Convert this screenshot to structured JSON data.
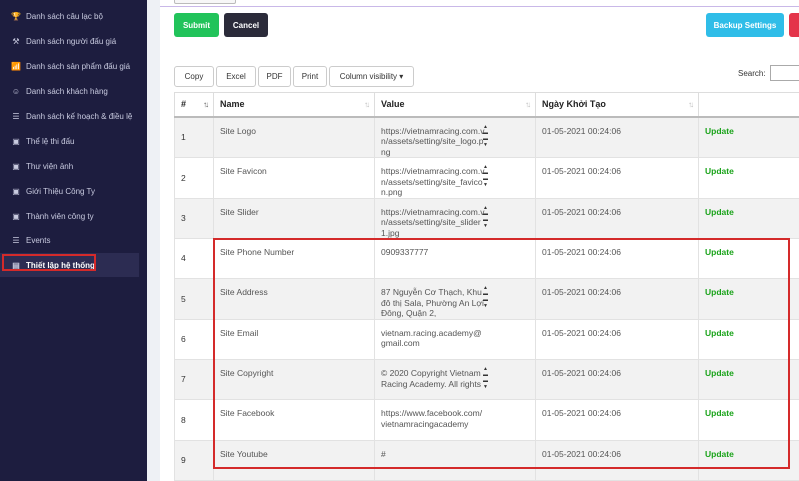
{
  "sidebar": {
    "items": [
      {
        "label": "Danh sách câu lạc bộ",
        "icon": "trophy-icon",
        "glyph": "🏆"
      },
      {
        "label": "Danh sách người đấu giá",
        "icon": "gavel-icon",
        "glyph": "⚒"
      },
      {
        "label": "Danh sách sản phẩm đấu giá",
        "icon": "bar-chart-icon",
        "glyph": "📶"
      },
      {
        "label": "Danh sách khách hàng",
        "icon": "user-circle-icon",
        "glyph": "☺"
      },
      {
        "label": "Danh sách kế hoạch & điều lệ",
        "icon": "list-icon",
        "glyph": "☰"
      },
      {
        "label": "Thể lệ thi đấu",
        "icon": "image-icon",
        "glyph": "▣"
      },
      {
        "label": "Thư viện ảnh",
        "icon": "image-icon",
        "glyph": "▣"
      },
      {
        "label": "Giới Thiệu Công Ty",
        "icon": "image-icon",
        "glyph": "▣"
      },
      {
        "label": "Thành viên công ty",
        "icon": "image-icon",
        "glyph": "▣"
      },
      {
        "label": "Events",
        "icon": "list-icon",
        "glyph": "☰"
      },
      {
        "label": "Thiết lập hệ thống",
        "icon": "settings-card-icon",
        "glyph": "▤",
        "active": true
      }
    ]
  },
  "actions": {
    "submit": "Submit",
    "cancel": "Cancel",
    "backup": "Backup Settings",
    "colors": {
      "submit": "#21c35a",
      "cancel": "#2b2b3a",
      "backup": "#2fbde8",
      "danger": "#e4344a"
    }
  },
  "table_tools": {
    "buttons": [
      "Copy",
      "Excel",
      "PDF",
      "Print",
      "Column visibility ▾"
    ],
    "search_label": "Search:"
  },
  "table": {
    "headers": [
      "#",
      "Name",
      "Value",
      "Ngày Khởi Tạo",
      ""
    ],
    "rows": [
      {
        "num": "1",
        "name": "Site Logo",
        "value": "https://vietnamracing.com.vn/assets/setting/site_logo.png",
        "scroll": true,
        "date": "01-05-2021 00:24:06",
        "action": "Update"
      },
      {
        "num": "2",
        "name": "Site Favicon",
        "value": "https://vietnamracing.com.vn/assets/setting/site_favicon.png",
        "scroll": true,
        "date": "01-05-2021 00:24:06",
        "action": "Update"
      },
      {
        "num": "3",
        "name": "Site Slider",
        "value": "https://vietnamracing.com.vn/assets/setting/site_slider1.jpg",
        "scroll": true,
        "date": "01-05-2021 00:24:06",
        "action": "Update"
      },
      {
        "num": "4",
        "name": "Site Phone Number",
        "value": "0909337777",
        "scroll": false,
        "date": "01-05-2021 00:24:06",
        "action": "Update"
      },
      {
        "num": "5",
        "name": "Site Address",
        "value": "87 Nguyễn Cơ Thạch, Khu đô thị Sala, Phường An Lợi Đông, Quận 2,",
        "scroll": true,
        "date": "01-05-2021 00:24:06",
        "action": "Update"
      },
      {
        "num": "6",
        "name": "Site Email",
        "value": "vietnam.racing.academy@gmail.com",
        "scroll": false,
        "date": "01-05-2021 00:24:06",
        "action": "Update"
      },
      {
        "num": "7",
        "name": "Site Copyright",
        "value": "© 2020 Copyright Vietnam Racing Academy. All rights",
        "scroll": true,
        "date": "01-05-2021 00:24:06",
        "action": "Update"
      },
      {
        "num": "8",
        "name": "Site Facebook",
        "value": "https://www.facebook.com/vietnamracingacademy",
        "scroll": false,
        "date": "01-05-2021 00:24:06",
        "action": "Update"
      },
      {
        "num": "9",
        "name": "Site Youtube",
        "value": "#",
        "scroll": false,
        "date": "01-05-2021 00:24:06",
        "action": "Update"
      }
    ]
  }
}
